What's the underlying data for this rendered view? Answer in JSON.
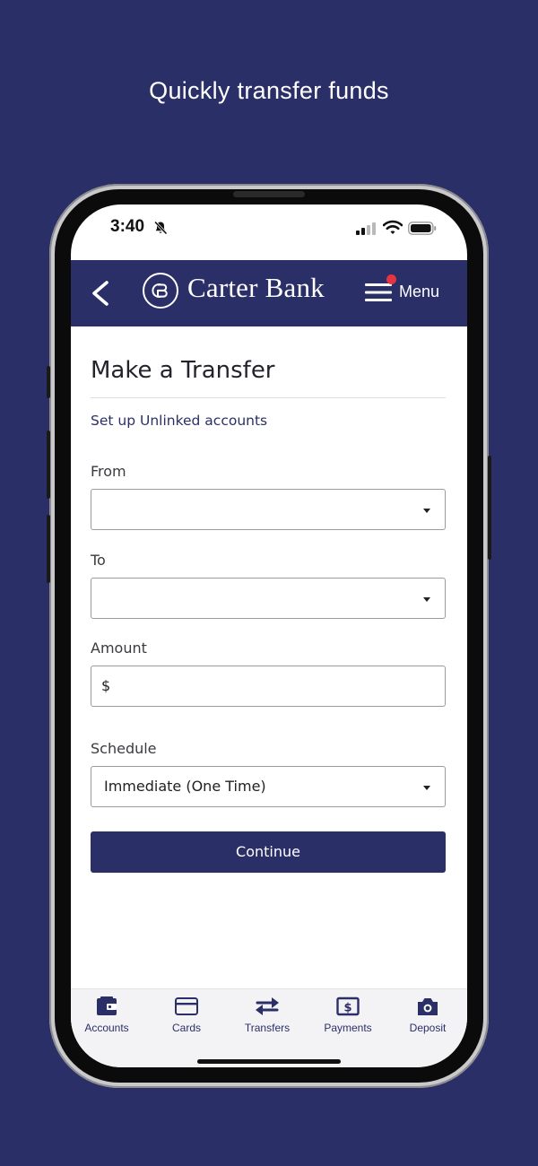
{
  "promo": {
    "headline": "Quickly transfer funds"
  },
  "status_bar": {
    "time": "3:40"
  },
  "header": {
    "brand": "Carter Bank",
    "menu_label": "Menu"
  },
  "form": {
    "title": "Make a Transfer",
    "unlinked_link": "Set up Unlinked accounts",
    "from_label": "From",
    "from_value": "",
    "to_label": "To",
    "to_value": "",
    "amount_label": "Amount",
    "amount_prefix": "$",
    "amount_value": "",
    "schedule_label": "Schedule",
    "schedule_value": "Immediate (One Time)",
    "continue_label": "Continue"
  },
  "tabs": [
    {
      "label": "Accounts",
      "icon": "wallet-icon"
    },
    {
      "label": "Cards",
      "icon": "card-icon"
    },
    {
      "label": "Transfers",
      "icon": "transfer-arrows-icon"
    },
    {
      "label": "Payments",
      "icon": "dollar-bill-icon"
    },
    {
      "label": "Deposit",
      "icon": "camera-icon"
    }
  ],
  "colors": {
    "brand_navy": "#2b2f67",
    "notification_dot": "#e5343f"
  }
}
